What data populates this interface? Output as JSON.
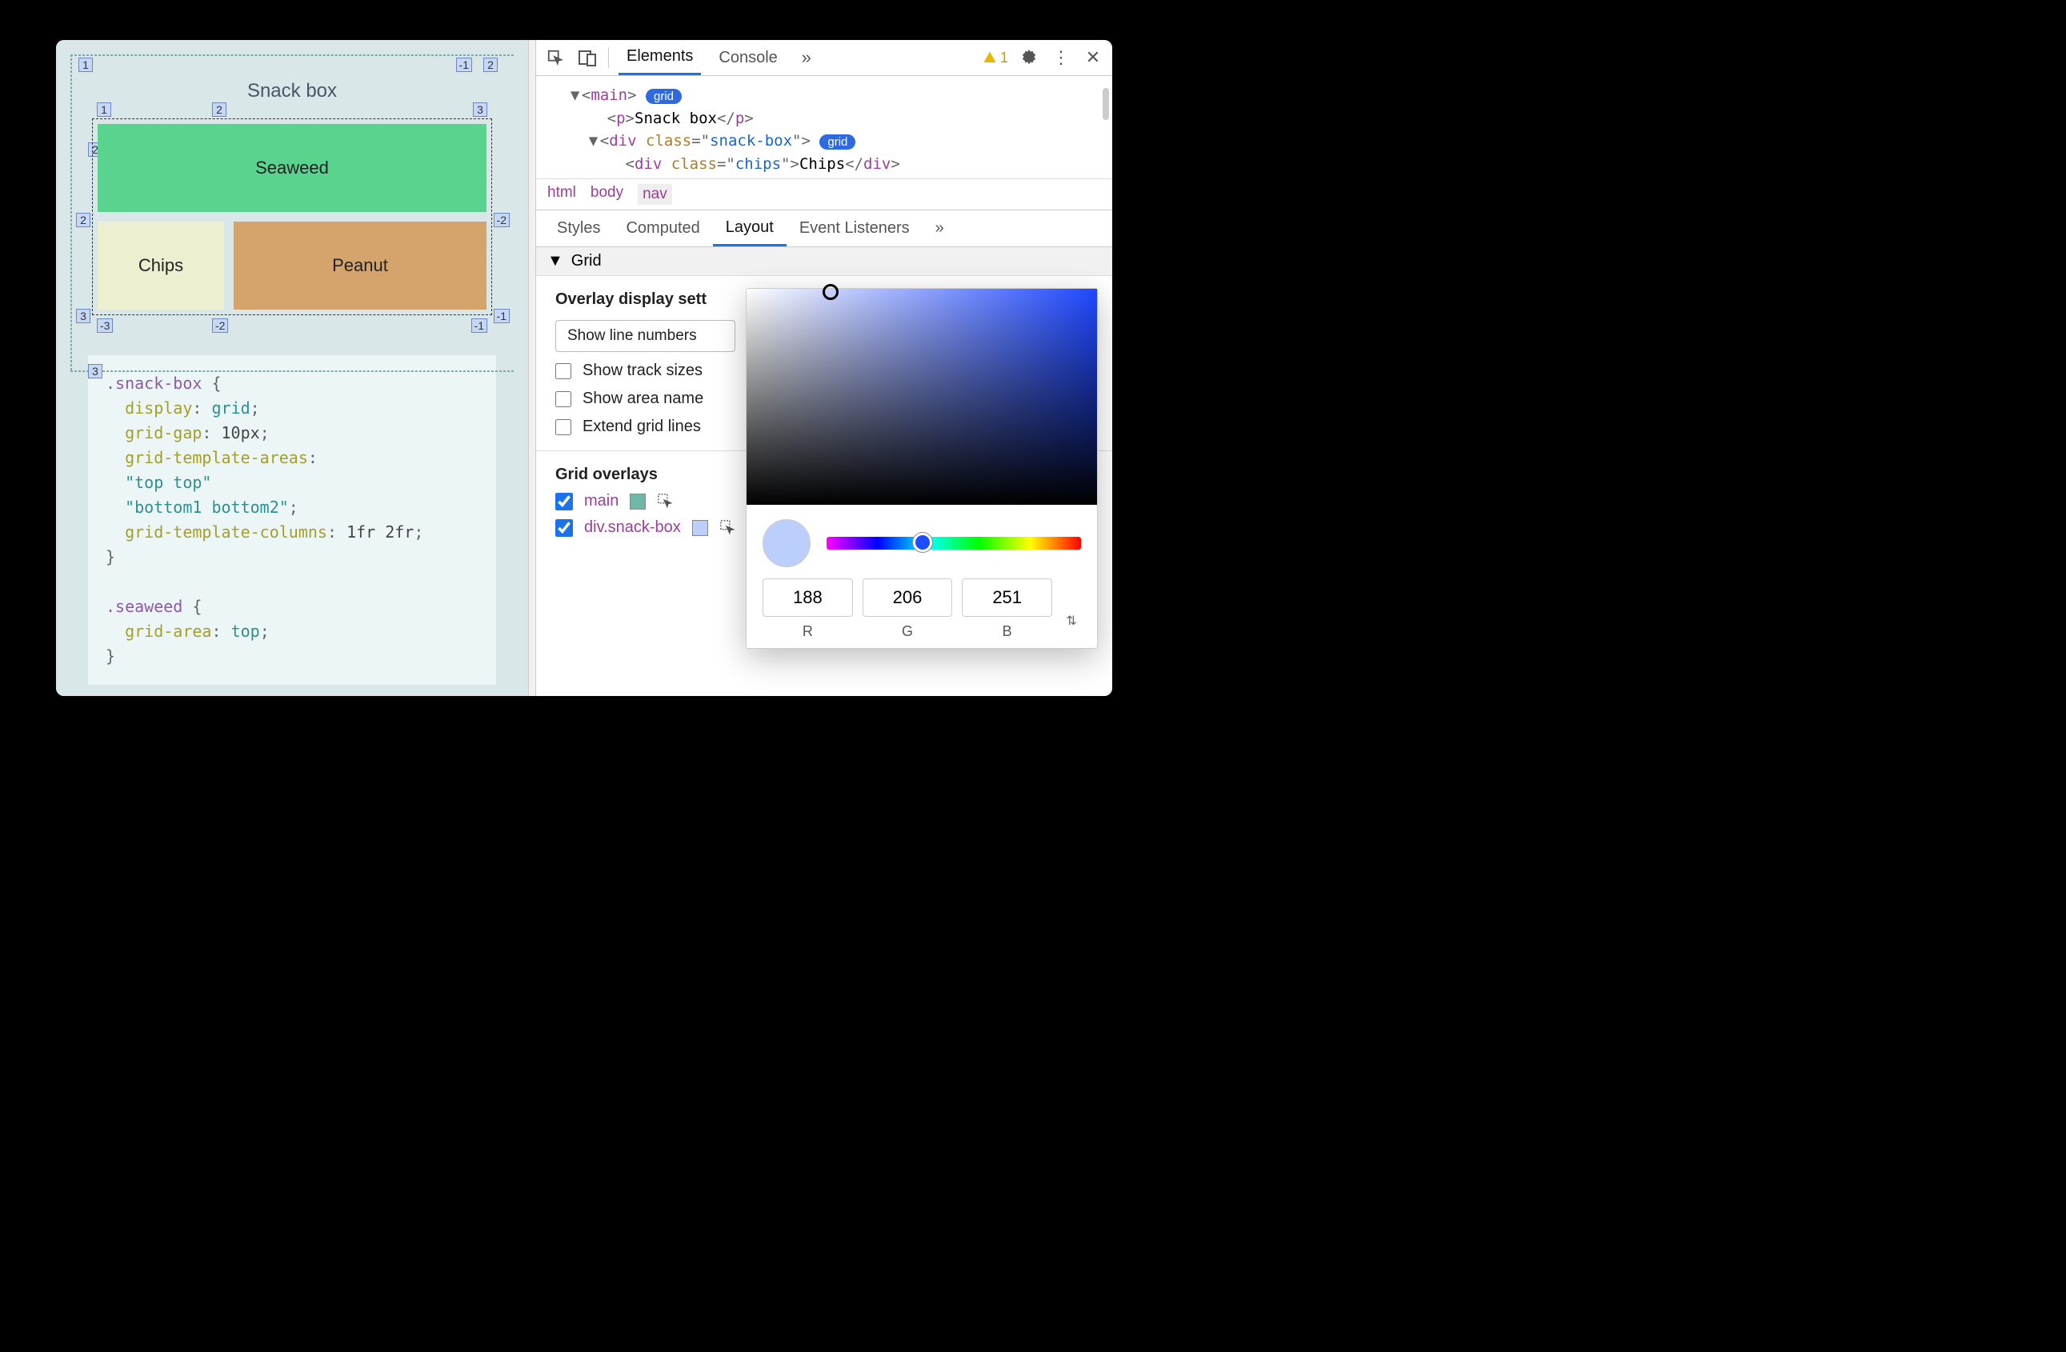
{
  "viewport": {
    "title": "Snack box",
    "grid_items": {
      "seaweed": "Seaweed",
      "chips": "Chips",
      "peanut": "Peanut"
    },
    "line_numbers": {
      "outer_tl": "1",
      "outer_tr_neg": "-1",
      "outer_tr_col": "2",
      "row2_left": "2",
      "row3_left": "3",
      "col1": "1",
      "col2": "2",
      "col3": "3",
      "inner_r2_l": "2",
      "inner_r2_r": "-2",
      "inner_b_l": "3",
      "inner_b_c_neg": "-3",
      "inner_b_c2_neg": "-2",
      "inner_b_r_neg": "-1",
      "outer_b_c_neg2": "-2"
    },
    "css": {
      "rule1_selector": ".snack-box",
      "rule1_props": [
        {
          "p": "display",
          "v": "grid",
          "t": "kw"
        },
        {
          "p": "grid-gap",
          "v": "10px",
          "t": "num"
        },
        {
          "p": "grid-template-areas",
          "v": "",
          "t": "none"
        },
        {
          "p": "",
          "v": "\"top top\"",
          "t": "str"
        },
        {
          "p": "",
          "v": "\"bottom1 bottom2\"",
          "t": "str",
          "semi": true
        },
        {
          "p": "grid-template-columns",
          "v": "1fr 2fr",
          "t": "num",
          "semi": true
        }
      ],
      "rule2_selector": ".seaweed",
      "rule2_props": [
        {
          "p": "grid-area",
          "v": "top",
          "t": "kw",
          "semi": true
        }
      ]
    }
  },
  "devtools": {
    "tabs": {
      "elements": "Elements",
      "console": "Console"
    },
    "warning_count": "1",
    "dom": {
      "l1_tag": "main",
      "l1_badge": "grid",
      "l2_tag": "p",
      "l2_text": "Snack box",
      "l3_tag": "div",
      "l3_attr_name": "class",
      "l3_attr_val": "snack-box",
      "l3_badge": "grid",
      "l4_tag": "div",
      "l4_attr_name": "class",
      "l4_attr_val": "chips",
      "l4_text": "Chips"
    },
    "breadcrumb": [
      "html",
      "body",
      "nav"
    ],
    "subtabs": {
      "styles": "Styles",
      "computed": "Computed",
      "layout": "Layout",
      "listeners": "Event Listeners"
    },
    "grid_section": {
      "title": "Grid",
      "overlay_heading": "Overlay display sett",
      "dropdown": "Show line numbers",
      "cb_track": "Show track sizes",
      "cb_area": "Show area name",
      "cb_extend": "Extend grid lines",
      "overlays_heading": "Grid overlays",
      "overlay1": "main",
      "overlay2": "div.snack-box"
    },
    "picker": {
      "r": "188",
      "g": "206",
      "b": "251",
      "r_label": "R",
      "g_label": "G",
      "b_label": "B"
    }
  }
}
